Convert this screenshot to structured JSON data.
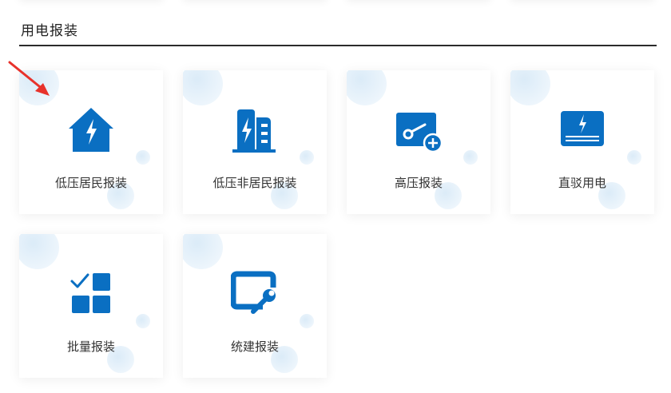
{
  "section": {
    "title": "用电报装"
  },
  "cards": [
    {
      "label": "低压居民报装",
      "icon": "house-lightning-icon"
    },
    {
      "label": "低压非居民报装",
      "icon": "building-lightning-icon"
    },
    {
      "label": "高压报装",
      "icon": "meter-plus-icon"
    },
    {
      "label": "直驳用电",
      "icon": "panel-lightning-icon"
    },
    {
      "label": "批量报装",
      "icon": "checklist-grid-icon"
    },
    {
      "label": "统建报装",
      "icon": "window-wrench-icon"
    }
  ],
  "colors": {
    "icon": "#0a6fc2",
    "bubble": "#dcecf8",
    "arrow": "#e8322b",
    "text": "#333333"
  }
}
